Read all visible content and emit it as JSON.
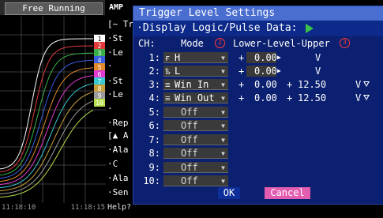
{
  "status": {
    "run_state": "Free Running"
  },
  "graph": {
    "time_start": "11:18:10",
    "time_end": "11:18:15",
    "channel_markers": [
      {
        "label": "1",
        "color": "#ffffff"
      },
      {
        "label": "2",
        "color": "#e23a3a"
      },
      {
        "label": "3",
        "color": "#3ab04a"
      },
      {
        "label": "4",
        "color": "#3a5ee0"
      },
      {
        "label": "5",
        "color": "#e08a2a"
      },
      {
        "label": "6",
        "color": "#e03ad0"
      },
      {
        "label": "7",
        "color": "#3ac8d0"
      },
      {
        "label": "8",
        "color": "#c8a03a"
      },
      {
        "label": "9",
        "color": "#9a9a9a"
      },
      {
        "label": "10",
        "color": "#b8e04a"
      }
    ]
  },
  "amp_panel": {
    "tab": "AMP",
    "lines": [
      "[~ Tr",
      "·St",
      "·Le",
      "·",
      "·St",
      "·Le",
      "·",
      "·Rep",
      "[▲ A",
      "·Ala",
      "·C",
      "·Ala",
      "·Sen"
    ],
    "help": "Help?"
  },
  "dialog": {
    "title": "Trigger Level Settings",
    "subline": "·Display Logic/Pulse Data:",
    "col_ch": "CH:",
    "col_mode": "Mode",
    "col_mode_badge": "2",
    "col_level": "Lower-Level-Upper",
    "col_level_badge": "3",
    "rows": [
      {
        "num": "1:",
        "mode_icon": "ғ",
        "mode": "H",
        "lower_sign": "+",
        "lower": "0.00",
        "unit": "V",
        "upper_sign": "",
        "upper": ""
      },
      {
        "num": "2:",
        "mode_icon": "ѣ",
        "mode": "L",
        "lower_sign": "+",
        "lower": "0.00",
        "unit": "V",
        "upper_sign": "",
        "upper": ""
      },
      {
        "num": "3:",
        "mode_icon": "≡",
        "mode": "Win In",
        "lower_sign": "+",
        "lower": "0.00",
        "upper_sign": "+",
        "upper": "12.50",
        "unit": "V"
      },
      {
        "num": "4:",
        "mode_icon": "≡",
        "mode": "Win Out",
        "lower_sign": "+",
        "lower": "0.00",
        "upper_sign": "+",
        "upper": "12.50",
        "unit": "V"
      },
      {
        "num": "5:",
        "mode": "Off"
      },
      {
        "num": "6:",
        "mode": "Off"
      },
      {
        "num": "7:",
        "mode": "Off"
      },
      {
        "num": "8:",
        "mode": "Off"
      },
      {
        "num": "9:",
        "mode": "Off"
      },
      {
        "num": "10:",
        "mode": "Off"
      }
    ],
    "ok_label": "OK",
    "cancel_label": "Cancel"
  }
}
